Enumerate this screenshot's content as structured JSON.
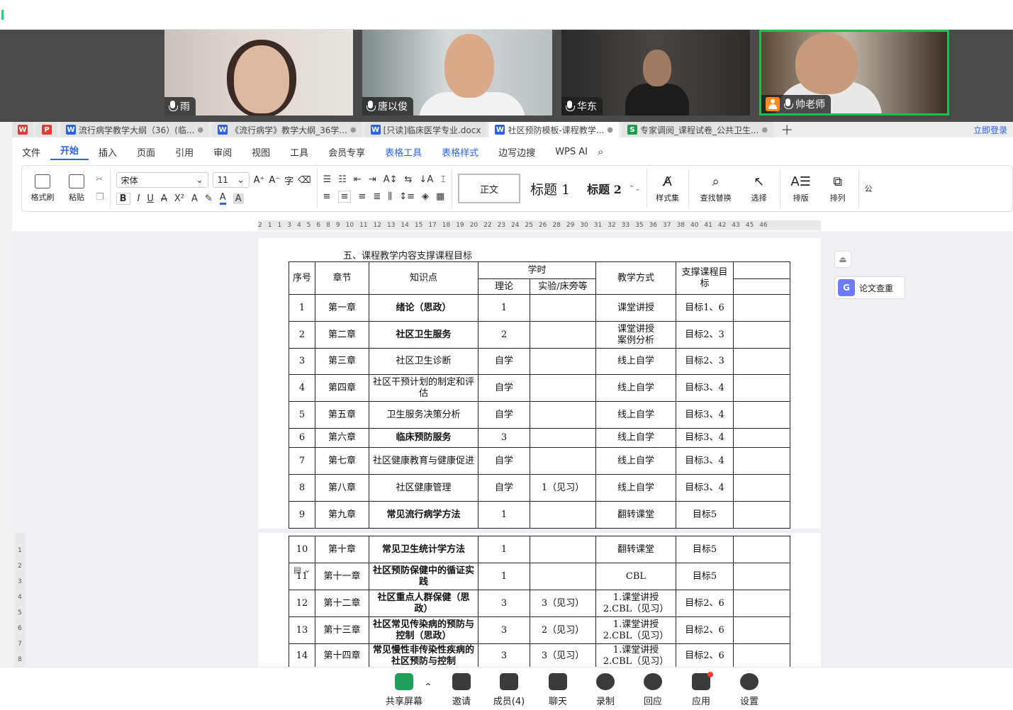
{
  "participants": [
    {
      "name": "雨"
    },
    {
      "name": "唐以俊"
    },
    {
      "name": "华东"
    },
    {
      "name": "帅老师"
    }
  ],
  "tabs": [
    {
      "label": "流行病学教学大纲（36）(临...",
      "icon": "W"
    },
    {
      "label": "《流行病学》教学大纲_36学...",
      "icon": "W"
    },
    {
      "label": "[只读]临床医学专业.docx",
      "icon": "W"
    },
    {
      "label": "社区预防模板-课程教学...",
      "icon": "W"
    },
    {
      "label": "专家调阅_课程试卷_公共卫生...",
      "icon": "S"
    }
  ],
  "login_label": "立即登录",
  "ribbon_tabs": [
    "文件",
    "开始",
    "插入",
    "页面",
    "引用",
    "审阅",
    "视图",
    "工具",
    "会员专享",
    "表格工具",
    "表格样式",
    "边写边搜",
    "WPS AI"
  ],
  "ribbon": {
    "format_painter": "格式刷",
    "paste": "粘贴",
    "font_name": "宋体",
    "font_size": "11",
    "style_normal": "正文",
    "style_h1": "标题 1",
    "style_h2": "标题 2",
    "styles_set": "样式集",
    "find_replace": "查找替换",
    "select": "选择",
    "layout": "排版",
    "arrange": "排列",
    "more": "公"
  },
  "ruler_marks": [
    "2",
    "1",
    "1",
    "3",
    "4",
    "5",
    "6",
    "8",
    "9",
    "10",
    "11",
    "12",
    "13",
    "14",
    "15",
    "17",
    "18",
    "19",
    "20",
    "22",
    "23",
    "24",
    "25",
    "26",
    "28",
    "29",
    "30",
    "31",
    "32",
    "33",
    "35",
    "36",
    "37",
    "38",
    "40",
    "41",
    "42",
    "43",
    "45",
    "46"
  ],
  "section_title": "五、课程教学内容支撑课程目标",
  "table_headers": {
    "no": "序号",
    "chapter": "章节",
    "knowledge": "知识点",
    "hours": "学时",
    "theory": "理论",
    "lab": "实验/床旁等",
    "method": "教学方式",
    "target": "支撑课程目标"
  },
  "rows_page1": [
    {
      "no": "1",
      "chapter": "第一章",
      "kp": "绪论（思政）",
      "bold": true,
      "theory": "1",
      "lab": "",
      "method": "课堂讲授",
      "target": "目标1、6"
    },
    {
      "no": "2",
      "chapter": "第二章",
      "kp": "社区卫生服务",
      "bold": true,
      "theory": "2",
      "lab": "",
      "method": "课堂讲授\n案例分析",
      "target": "目标2、3"
    },
    {
      "no": "3",
      "chapter": "第三章",
      "kp": "社区卫生诊断",
      "bold": false,
      "theory": "自学",
      "lab": "",
      "method": "线上自学",
      "target": "目标2、3"
    },
    {
      "no": "4",
      "chapter": "第四章",
      "kp": "社区干预计划的制定和评估",
      "bold": false,
      "theory": "自学",
      "lab": "",
      "method": "线上自学",
      "target": "目标3、4"
    },
    {
      "no": "5",
      "chapter": "第五章",
      "kp": "卫生服务决策分析",
      "bold": false,
      "theory": "自学",
      "lab": "",
      "method": "线上自学",
      "target": "目标3、4"
    },
    {
      "no": "6",
      "chapter": "第六章",
      "kp": "临床预防服务",
      "bold": true,
      "theory": "3",
      "lab": "",
      "method": "线上自学",
      "target": "目标3、4"
    },
    {
      "no": "7",
      "chapter": "第七章",
      "kp": "社区健康教育与健康促进",
      "bold": false,
      "theory": "自学",
      "lab": "",
      "method": "线上自学",
      "target": "目标3、4"
    },
    {
      "no": "8",
      "chapter": "第八章",
      "kp": "社区健康管理",
      "bold": false,
      "theory": "自学",
      "lab": "1（见习）",
      "method": "线上自学",
      "target": "目标3、4"
    },
    {
      "no": "9",
      "chapter": "第九章",
      "kp": "常见流行病学方法",
      "bold": true,
      "theory": "1",
      "lab": "",
      "method": "翻转课堂",
      "target": "目标5"
    }
  ],
  "rows_page2": [
    {
      "no": "10",
      "chapter": "第十章",
      "kp": "常见卫生统计学方法",
      "bold": true,
      "theory": "1",
      "lab": "",
      "method": "翻转课堂",
      "target": "目标5"
    },
    {
      "no": "11",
      "chapter": "第十一章",
      "kp": "社区预防保健中的循证实践",
      "bold": true,
      "theory": "1",
      "lab": "",
      "method": "CBL",
      "target": "目标5"
    },
    {
      "no": "12",
      "chapter": "第十二章",
      "kp": "社区重点人群保健（思政）",
      "bold": true,
      "theory": "3",
      "lab": "3（见习）",
      "method": "1.课堂讲授\n2.CBL（见习）",
      "target": "目标2、6"
    },
    {
      "no": "13",
      "chapter": "第十三章",
      "kp": "社区常见传染病的预防与控制（思政）",
      "bold": true,
      "theory": "3",
      "lab": "2（见习）",
      "method": "1.课堂讲授\n2.CBL（见习）",
      "target": "目标2、6"
    },
    {
      "no": "14",
      "chapter": "第十四章",
      "kp": "常见慢性非传染性疾病的社区预防与控制",
      "bold": true,
      "theory": "3",
      "lab": "3（见习）",
      "method": "1.课堂讲授\n2.CBL（见习）",
      "target": "目标2、6"
    }
  ],
  "side_panel": {
    "plagiarism_check": "论文查重"
  },
  "vruler_marks": [
    "1",
    "2",
    "3",
    "4",
    "5",
    "6",
    "7",
    "8"
  ],
  "bottom_bar": [
    "共享屏幕",
    "邀请",
    "成员(4)",
    "聊天",
    "录制",
    "回应",
    "应用",
    "设置"
  ]
}
